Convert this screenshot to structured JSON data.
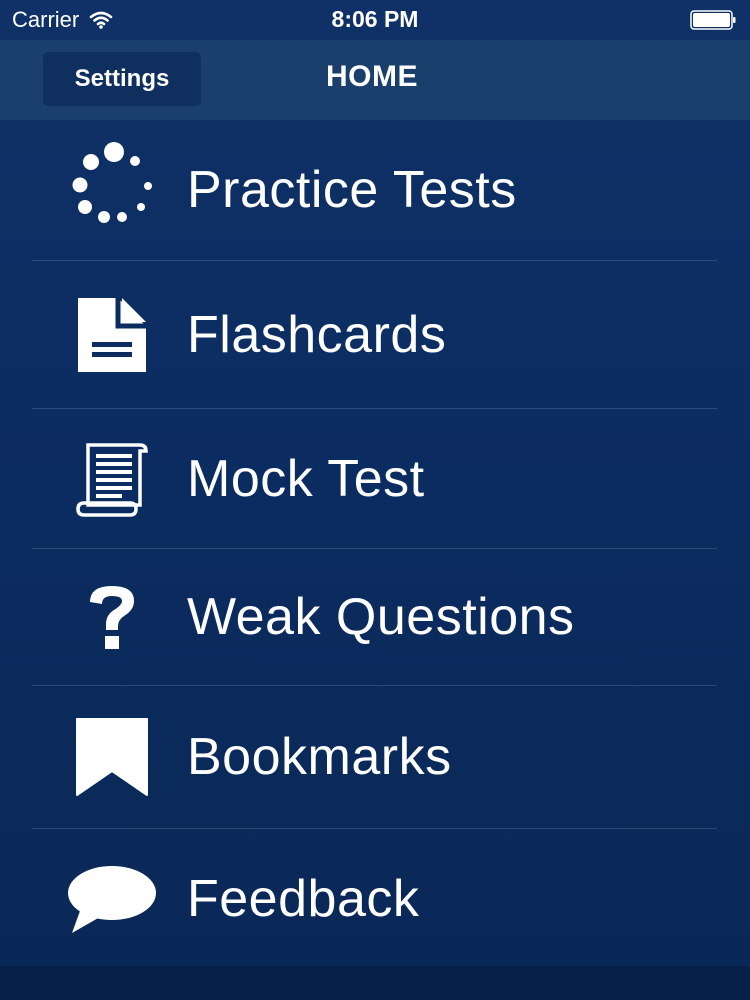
{
  "status_bar": {
    "carrier": "Carrier",
    "time": "8:06 PM",
    "wifi_icon": "wifi-icon",
    "battery_icon": "battery-icon"
  },
  "nav": {
    "settings_label": "Settings",
    "title": "HOME"
  },
  "menu": {
    "items": [
      {
        "label": "Practice Tests",
        "icon": "loading-dots-icon"
      },
      {
        "label": "Flashcards",
        "icon": "document-icon"
      },
      {
        "label": "Mock Test",
        "icon": "scroll-icon"
      },
      {
        "label": "Weak Questions",
        "icon": "question-mark-icon"
      },
      {
        "label": "Bookmarks",
        "icon": "bookmark-icon"
      },
      {
        "label": "Feedback",
        "icon": "speech-bubble-icon"
      }
    ]
  },
  "colors": {
    "background": "#0b2c60",
    "nav_bar": "#1b3f6d",
    "settings_button": "#0f2f5e",
    "text": "#ffffff"
  }
}
